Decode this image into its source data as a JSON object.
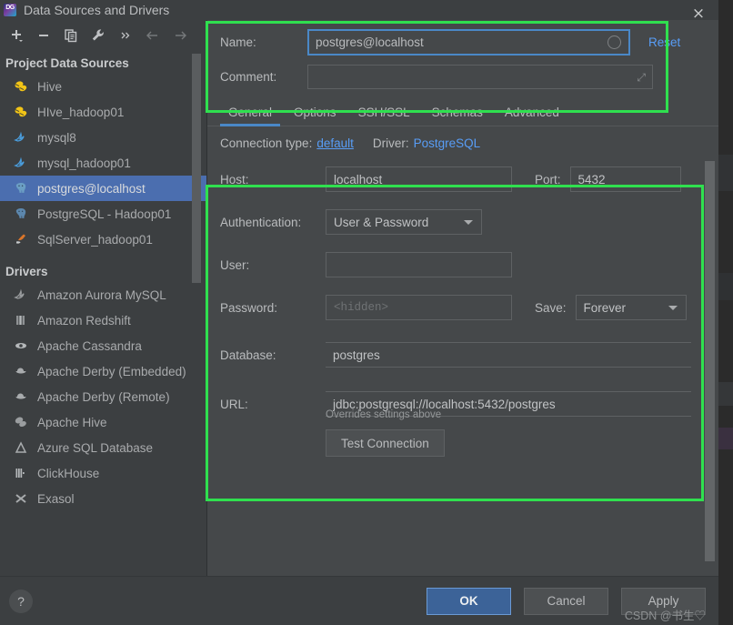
{
  "window": {
    "title": "Data Sources and Drivers",
    "logo_icon": "datagrip-logo-icon",
    "close_icon": "×"
  },
  "toolbar": {
    "items": [
      {
        "name": "add-button",
        "glyph": "+",
        "dim": false
      },
      {
        "name": "remove-button",
        "glyph": "−",
        "dim": false
      },
      {
        "name": "copy-button",
        "glyph": "❐",
        "dim": false
      },
      {
        "name": "properties-button",
        "glyph": "🔧",
        "dim": false
      },
      {
        "name": "more-button",
        "glyph": "»",
        "dim": false
      },
      {
        "name": "back-button",
        "glyph": "←",
        "dim": true
      },
      {
        "name": "forward-button",
        "glyph": "→",
        "dim": true
      }
    ]
  },
  "sidebar": {
    "groups": [
      {
        "title": "Project Data Sources",
        "items": [
          {
            "label": "Hive",
            "icon": "hive-icon",
            "glyph": "🐝",
            "selected": false
          },
          {
            "label": "HIve_hadoop01",
            "icon": "hive-icon",
            "glyph": "🐝",
            "selected": false
          },
          {
            "label": "mysql8",
            "icon": "mysql-icon",
            "glyph": "🐬",
            "selected": false
          },
          {
            "label": "mysql_hadoop01",
            "icon": "mysql-icon",
            "glyph": "🐬",
            "selected": false
          },
          {
            "label": "postgres@localhost",
            "icon": "postgres-icon",
            "glyph": "🐘",
            "selected": true
          },
          {
            "label": "PostgreSQL - Hadoop01",
            "icon": "postgres-icon",
            "glyph": "🐘",
            "selected": false
          },
          {
            "label": "SqlServer_hadoop01",
            "icon": "sqlserver-icon",
            "glyph": "🐦",
            "selected": false
          }
        ]
      },
      {
        "title": "Drivers",
        "items": [
          {
            "label": "Amazon Aurora MySQL",
            "icon": "mysql-icon",
            "glyph": "🐬",
            "selected": false
          },
          {
            "label": "Amazon Redshift",
            "icon": "redshift-icon",
            "glyph": "▥",
            "selected": false
          },
          {
            "label": "Apache Cassandra",
            "icon": "cassandra-icon",
            "glyph": "👁",
            "selected": false
          },
          {
            "label": "Apache Derby (Embedded)",
            "icon": "derby-icon",
            "glyph": "🎩",
            "selected": false
          },
          {
            "label": "Apache Derby (Remote)",
            "icon": "derby-icon",
            "glyph": "🎩",
            "selected": false
          },
          {
            "label": "Apache Hive",
            "icon": "hive-icon",
            "glyph": "🐝",
            "selected": false
          },
          {
            "label": "Azure SQL Database",
            "icon": "azure-icon",
            "glyph": "▲",
            "selected": false
          },
          {
            "label": "ClickHouse",
            "icon": "clickhouse-icon",
            "glyph": "▥",
            "selected": false
          },
          {
            "label": "Exasol",
            "icon": "exasol-icon",
            "glyph": "✖",
            "selected": false
          }
        ]
      }
    ]
  },
  "header": {
    "name_label": "Name:",
    "name_value": "postgres@localhost",
    "name_placeholder": "",
    "comment_label": "Comment:",
    "comment_value": "",
    "comment_placeholder": "",
    "reset_label": "Reset",
    "status_icon": "status-circle-icon",
    "expand_icon": "expand-diagonal-icon"
  },
  "tabs": [
    {
      "label": "General",
      "active": true
    },
    {
      "label": "Options",
      "active": false
    },
    {
      "label": "SSH/SSL",
      "active": false
    },
    {
      "label": "Schemas",
      "active": false
    },
    {
      "label": "Advanced",
      "active": false
    }
  ],
  "connection": {
    "type_label": "Connection type:",
    "type_value": "default",
    "driver_label": "Driver:",
    "driver_value": "PostgreSQL"
  },
  "form": {
    "host_label": "Host:",
    "host_value": "localhost",
    "port_label": "Port:",
    "port_value": "5432",
    "auth_label": "Authentication:",
    "auth_value": "User & Password",
    "user_label": "User:",
    "user_value": "",
    "password_label": "Password:",
    "password_placeholder": "<hidden>",
    "password_value": "",
    "save_label": "Save:",
    "save_value": "Forever",
    "database_label": "Database:",
    "database_value": "postgres",
    "url_label": "URL:",
    "url_value": "jdbc:postgresql://localhost:5432/postgres",
    "url_note": "Overrides settings above",
    "test_connection_label": "Test Connection"
  },
  "footer": {
    "help_label": "?",
    "ok_label": "OK",
    "cancel_label": "Cancel",
    "apply_label": "Apply",
    "watermark": "CSDN @书生♡"
  },
  "colors": {
    "accent_blue": "#4a88c7",
    "link_blue": "#589df6",
    "selection_blue": "#4b6eaf",
    "primary_button": "#3c6398",
    "annotation_green": "#2fe04f",
    "panel_bg": "#3c3f41",
    "content_bg": "#45484a"
  }
}
